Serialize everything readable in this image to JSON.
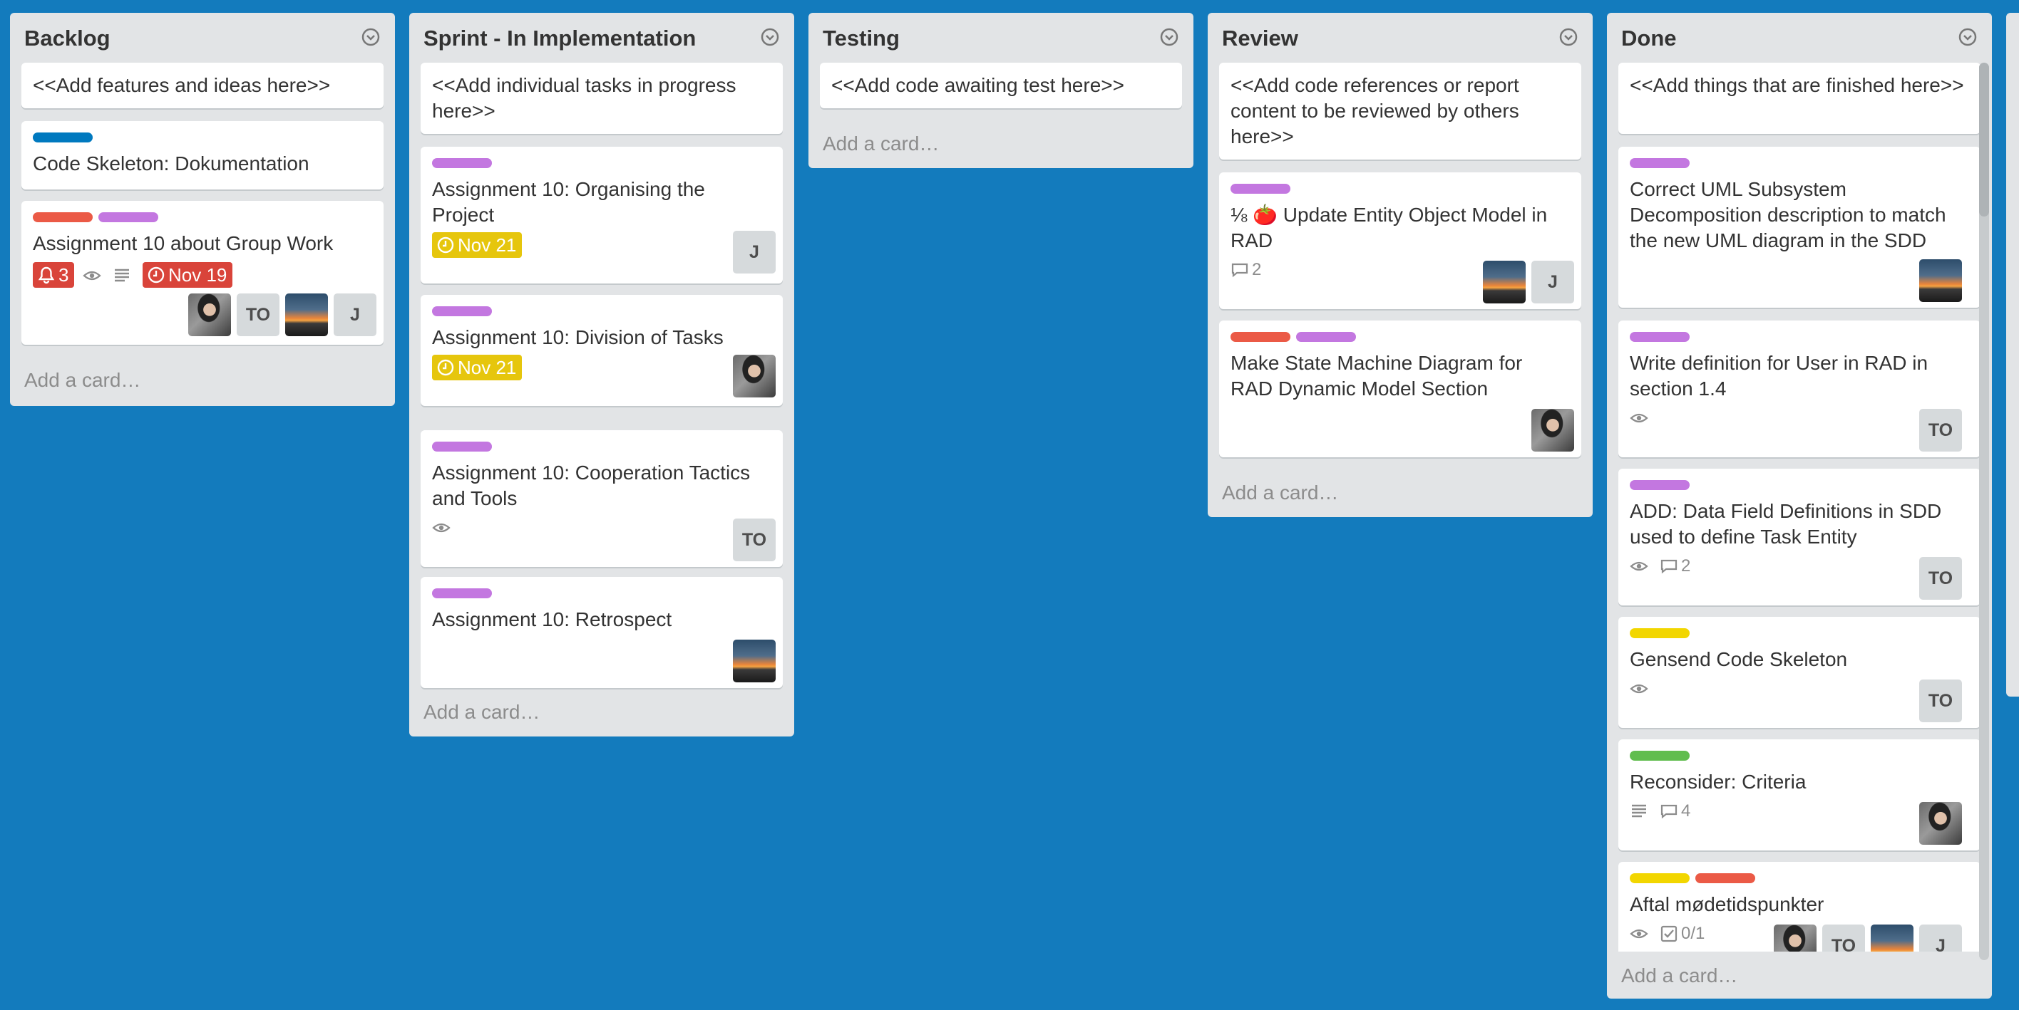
{
  "colors": {
    "board": "#137bbd",
    "list": "#e2e4e6",
    "blue": "#0079bf",
    "red": "#eb5a46",
    "purple": "#c377e0",
    "yellow": "#f2d600",
    "green": "#61bd4f",
    "due_yellow": "#e6c60d",
    "due_red": "#d9443a"
  },
  "lists": [
    {
      "title": "Backlog",
      "add": "Add a card…",
      "cards": [
        {
          "title": "<<Add features and ideas here>>"
        },
        {
          "title": "Code Skeleton: Dokumentation",
          "labels": [
            "blue"
          ]
        },
        {
          "title": "Assignment 10 about Group Work",
          "labels": [
            "red",
            "purple"
          ],
          "notif": "3",
          "due": "Nov 19",
          "members": [
            "TO",
            "J"
          ]
        }
      ]
    },
    {
      "title": "Sprint - In Implementation",
      "add": "Add a card…",
      "cards": [
        {
          "title": "<<Add individual tasks in progress here>>"
        },
        {
          "title": "Assignment 10: Organising the Project",
          "labels": [
            "purple"
          ],
          "due": "Nov 21",
          "members": [
            "J"
          ]
        },
        {
          "title": "Assignment 10: Division of Tasks",
          "labels": [
            "purple"
          ],
          "due": "Nov 21"
        },
        {
          "title": "Assignment 10: Cooperation Tactics and Tools",
          "labels": [
            "purple"
          ],
          "members": [
            "TO"
          ]
        },
        {
          "title": "Assignment 10: Retrospect",
          "labels": [
            "purple"
          ]
        }
      ]
    },
    {
      "title": "Testing",
      "add": "Add a card…",
      "cards": [
        {
          "title": "<<Add code awaiting test here>>"
        }
      ]
    },
    {
      "title": "Review",
      "add": "Add a card…",
      "cards": [
        {
          "title": "<<Add code references or report content to be reviewed by others here>>"
        },
        {
          "title": "⅛ 🍅 Update Entity Object Model in RAD",
          "labels": [
            "purple"
          ],
          "comments": "2",
          "members": [
            "J"
          ]
        },
        {
          "title": "Make State Machine Diagram for RAD Dynamic Model Section",
          "labels": [
            "red",
            "purple"
          ]
        }
      ]
    },
    {
      "title": "Done",
      "add": "Add a card…",
      "cards": [
        {
          "title": "<<Add things that are finished here>>"
        },
        {
          "title": "Correct UML Subsystem Decomposition description to match the new UML diagram in the SDD",
          "labels": [
            "purple"
          ]
        },
        {
          "title": "Write definition for User in RAD in section 1.4",
          "labels": [
            "purple"
          ],
          "members": [
            "TO"
          ]
        },
        {
          "title": "ADD: Data Field Definitions in SDD used to define Task Entity",
          "labels": [
            "purple"
          ],
          "comments": "2",
          "members": [
            "TO"
          ]
        },
        {
          "title": "Gensend Code Skeleton",
          "labels": [
            "yellow"
          ],
          "members": [
            "TO"
          ]
        },
        {
          "title": "Reconsider: Criteria",
          "labels": [
            "green"
          ],
          "comments": "4"
        },
        {
          "title": "Aftal mødetidspunkter",
          "labels": [
            "yellow",
            "red"
          ],
          "checklist": "0/1",
          "members": [
            "TO",
            "J"
          ]
        }
      ]
    }
  ]
}
